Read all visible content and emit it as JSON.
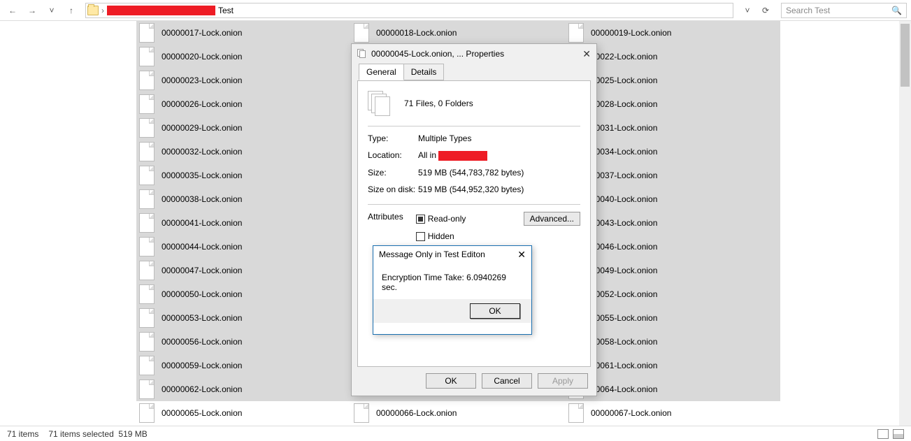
{
  "toolbar": {
    "breadcrumb_label": "Test",
    "search_placeholder": "Search Test"
  },
  "files_col1": [
    "00000017-Lock.onion",
    "00000020-Lock.onion",
    "00000023-Lock.onion",
    "00000026-Lock.onion",
    "00000029-Lock.onion",
    "00000032-Lock.onion",
    "00000035-Lock.onion",
    "00000038-Lock.onion",
    "00000041-Lock.onion",
    "00000044-Lock.onion",
    "00000047-Lock.onion",
    "00000050-Lock.onion",
    "00000053-Lock.onion",
    "00000056-Lock.onion",
    "00000059-Lock.onion",
    "00000062-Lock.onion",
    "00000065-Lock.onion"
  ],
  "files_col2": [
    "00000018-Lock.onion",
    "",
    "",
    "",
    "",
    "",
    "",
    "",
    "",
    "",
    "",
    "",
    "",
    "",
    "",
    "",
    "00000066-Lock.onion"
  ],
  "files_col3": [
    "00000019-Lock.onion",
    "00022-Lock.onion",
    "00025-Lock.onion",
    "00028-Lock.onion",
    "00031-Lock.onion",
    "00034-Lock.onion",
    "00037-Lock.onion",
    "00040-Lock.onion",
    "00043-Lock.onion",
    "00046-Lock.onion",
    "00049-Lock.onion",
    "00052-Lock.onion",
    "00055-Lock.onion",
    "00058-Lock.onion",
    "00061-Lock.onion",
    "00064-Lock.onion",
    "00000067-Lock.onion"
  ],
  "props": {
    "title": "00000045-Lock.onion, ... Properties",
    "tab_general": "General",
    "tab_details": "Details",
    "summary": "71 Files, 0 Folders",
    "type_label": "Type:",
    "type_val": "Multiple Types",
    "loc_label": "Location:",
    "loc_prefix": "All in ",
    "size_label": "Size:",
    "size_val": "519 MB (544,783,782 bytes)",
    "disk_label": "Size on disk:",
    "disk_val": "519 MB (544,952,320 bytes)",
    "attr_label": "Attributes",
    "ro_label": "Read-only",
    "hidden_label": "Hidden",
    "adv": "Advanced...",
    "ok": "OK",
    "cancel": "Cancel",
    "apply": "Apply"
  },
  "msg": {
    "title": "Message Only in Test Editon",
    "body": "Encryption Time Take: 6.0940269 sec.",
    "ok": "OK"
  },
  "status": {
    "count": "71 items",
    "sel": "71 items selected",
    "size": "519 MB"
  }
}
